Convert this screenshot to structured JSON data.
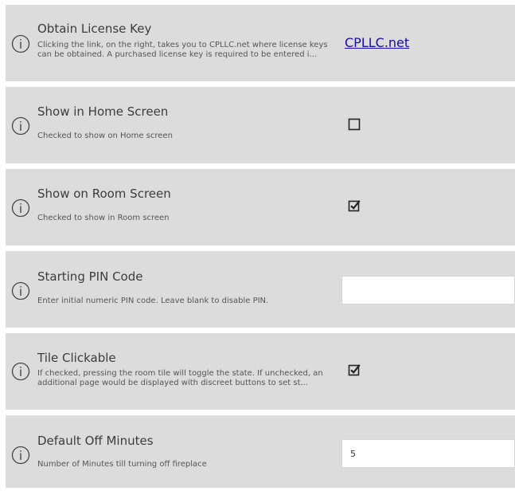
{
  "settings": [
    {
      "title": "Obtain License Key",
      "description": "Clicking the link, on the right, takes you to CPLLC.net where license keys can be obtained.  A purchased license key is required to be entered i...",
      "link_text": "CPLLC.net"
    },
    {
      "title": "Show in Home Screen",
      "description": "Checked to show on Home screen",
      "checked": false
    },
    {
      "title": "Show on Room Screen",
      "description": "Checked to show in Room screen",
      "checked": true
    },
    {
      "title": "Starting PIN Code",
      "description": "Enter initial numeric PIN code.  Leave blank to disable PIN.",
      "value": ""
    },
    {
      "title": "Tile Clickable",
      "description": "If checked, pressing the room tile will toggle the state.  If unchecked, an additional page would  be displayed with discreet buttons to set st...",
      "checked": true
    },
    {
      "title": "Default Off Minutes",
      "description": "Number of Minutes till turning off fireplace",
      "value": "5"
    }
  ],
  "icons": {
    "info": "info-circle-icon",
    "checkbox_checked": "checkbox-checked-icon",
    "checkbox_unchecked": "checkbox-unchecked-icon"
  },
  "colors": {
    "row_background": "#dcdcdc",
    "link": "#1a0dab",
    "text": "#3c3c3c"
  }
}
